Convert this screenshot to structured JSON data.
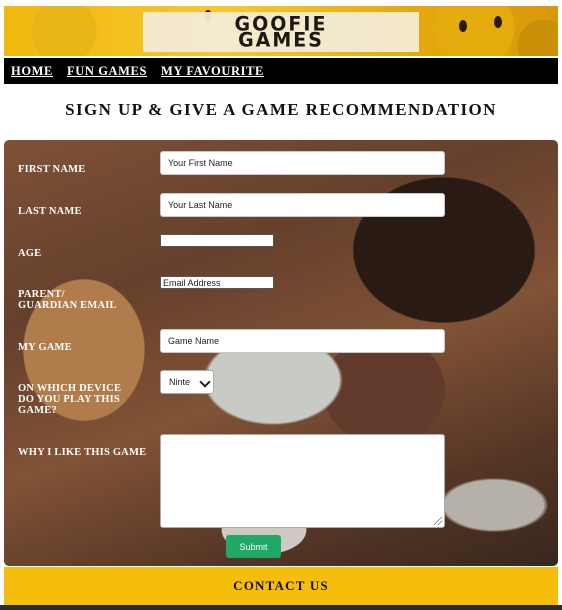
{
  "header": {
    "logo_line1": "GOOFIE",
    "logo_line2": "GAMES"
  },
  "nav": {
    "items": [
      {
        "label": "HOME"
      },
      {
        "label": "FUN GAMES"
      },
      {
        "label": "MY FAVOURITE"
      }
    ]
  },
  "page": {
    "title": "SIGN UP & GIVE A GAME RECOMMENDATION"
  },
  "form": {
    "first_name": {
      "label": "FIRST NAME",
      "placeholder": "Your First Name"
    },
    "last_name": {
      "label": "LAST NAME",
      "placeholder": "Your Last Name"
    },
    "age": {
      "label": "AGE",
      "value": ""
    },
    "email": {
      "label_line1": "PARENT/",
      "label_line2": "GUARDIAN EMAIL",
      "placeholder": "Email Address"
    },
    "my_game": {
      "label": "MY GAME",
      "placeholder": "Game Name"
    },
    "device": {
      "label_line1": "ON WHICH DEVICE",
      "label_line2": "DO YOU PLAY THIS",
      "label_line3": "GAME?",
      "selected": "Ninte"
    },
    "why": {
      "label": "WHY I LIKE THIS GAME"
    },
    "submit_label": "Submit"
  },
  "footer": {
    "label": "CONTACT US"
  },
  "colors": {
    "banner": "#f5bd0c",
    "nav_bg": "#000000",
    "submit_bg": "#1fa866",
    "footer_bg": "#f5bd0c"
  }
}
